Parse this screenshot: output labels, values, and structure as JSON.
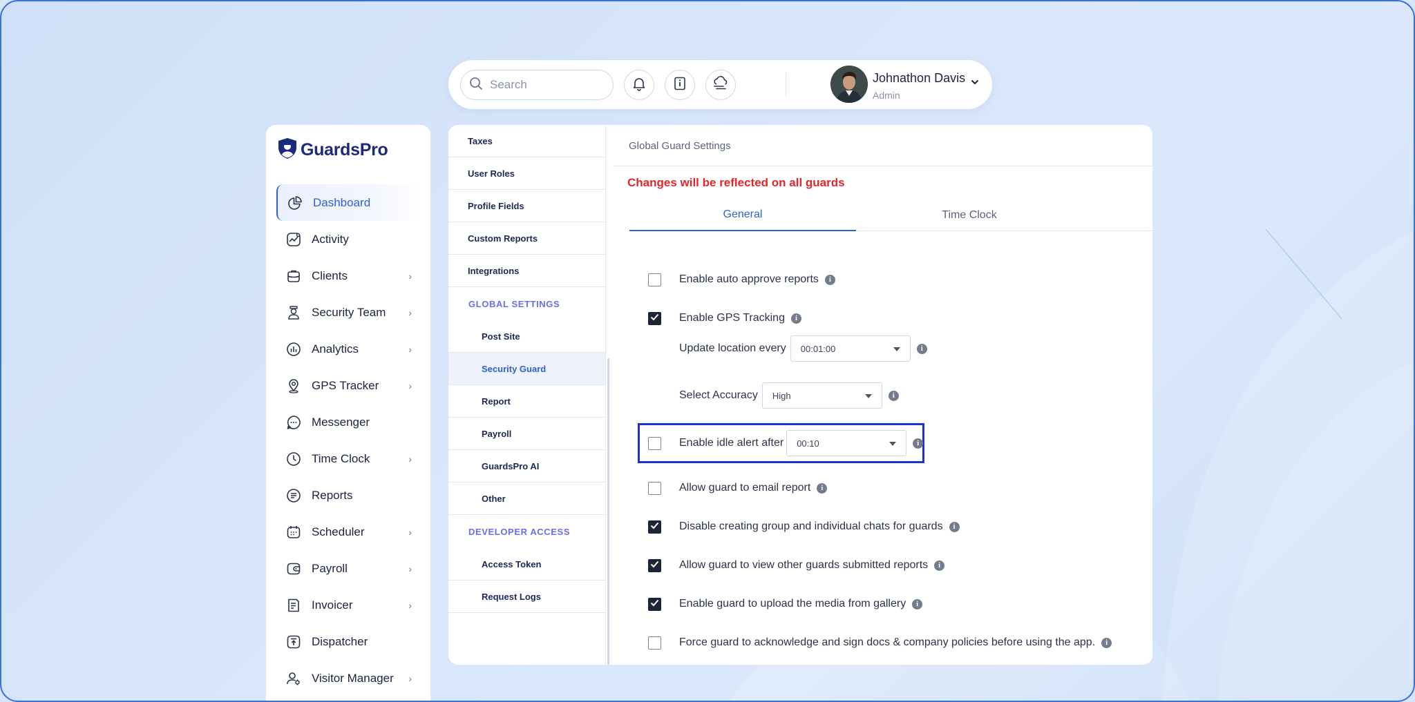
{
  "search": {
    "placeholder": "Search"
  },
  "user": {
    "name": "Johnathon Davis",
    "role": "Admin"
  },
  "brand": {
    "name": "GuardsPro"
  },
  "colors": {
    "accent": "#2f5fd6",
    "warning": "#e5252a",
    "highlight": "#1f2fd6",
    "checked": "#1c2438"
  },
  "sidebar": {
    "items": [
      {
        "label": "Dashboard",
        "icon": "pie-chart-icon",
        "chevron": false,
        "active": true
      },
      {
        "label": "Activity",
        "icon": "activity-icon",
        "chevron": false
      },
      {
        "label": "Clients",
        "icon": "briefcase-icon",
        "chevron": true
      },
      {
        "label": "Security Team",
        "icon": "guard-icon",
        "chevron": true
      },
      {
        "label": "Analytics",
        "icon": "bar-chart-icon",
        "chevron": true
      },
      {
        "label": "GPS Tracker",
        "icon": "location-pin-icon",
        "chevron": true
      },
      {
        "label": "Messenger",
        "icon": "chat-bubble-icon",
        "chevron": false
      },
      {
        "label": "Time Clock",
        "icon": "clock-icon",
        "chevron": true
      },
      {
        "label": "Reports",
        "icon": "document-list-icon",
        "chevron": false
      },
      {
        "label": "Scheduler",
        "icon": "calendar-icon",
        "chevron": true
      },
      {
        "label": "Payroll",
        "icon": "wallet-icon",
        "chevron": true
      },
      {
        "label": "Invoicer",
        "icon": "invoice-icon",
        "chevron": true
      },
      {
        "label": "Dispatcher",
        "icon": "upload-box-icon",
        "chevron": false
      },
      {
        "label": "Visitor Manager",
        "icon": "visitor-icon",
        "chevron": true
      }
    ]
  },
  "settings_nav": {
    "top_items": [
      "Taxes",
      "User Roles",
      "Profile Fields",
      "Custom Reports",
      "Integrations"
    ],
    "global_heading": "GLOBAL SETTINGS",
    "global_items": [
      "Post Site",
      "Security Guard",
      "Report",
      "Payroll",
      "GuardsPro AI",
      "Other"
    ],
    "developer_heading": "DEVELOPER ACCESS",
    "developer_items": [
      "Access Token",
      "Request Logs"
    ],
    "selected": "Security Guard"
  },
  "main": {
    "title": "Global Guard Settings",
    "notice": "Changes will be reflected on all guards",
    "tabs": [
      {
        "label": "General",
        "active": true
      },
      {
        "label": "Time Clock",
        "active": false
      }
    ],
    "options": {
      "auto_approve": {
        "label": "Enable auto approve reports",
        "checked": false
      },
      "gps_tracking": {
        "label": "Enable GPS Tracking",
        "checked": true
      },
      "update_location": {
        "label": "Update location every",
        "value": "00:01:00"
      },
      "accuracy": {
        "label": "Select Accuracy",
        "value": "High"
      },
      "idle_alert": {
        "label": "Enable idle alert after",
        "value": "00:10",
        "checked": false
      },
      "email_report": {
        "label": "Allow guard to email report",
        "checked": false
      },
      "disable_chats": {
        "label": "Disable creating group and individual chats for guards",
        "checked": true
      },
      "view_reports": {
        "label": "Allow guard to view other guards submitted reports",
        "checked": true
      },
      "upload_media": {
        "label": "Enable guard to upload the media from gallery",
        "checked": true
      },
      "acknowledge_docs": {
        "label": "Force guard to acknowledge and sign docs & company policies before using the app.",
        "checked": false
      }
    }
  }
}
